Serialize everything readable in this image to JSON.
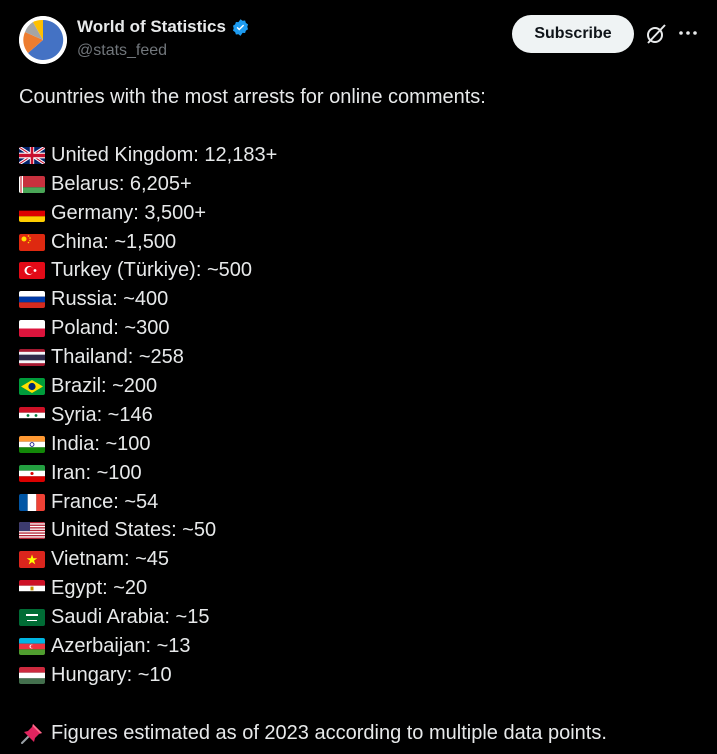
{
  "account": {
    "display_name": "World of Statistics",
    "handle": "@stats_feed",
    "verified": true,
    "avatar_icon": "pie-chart-avatar"
  },
  "actions": {
    "subscribe_label": "Subscribe",
    "grok_icon": "grok-icon",
    "more_icon": "more-icon"
  },
  "tweet": {
    "intro": "Countries with the most arrests for online comments:",
    "items": [
      {
        "flag": "united-kingdom-flag",
        "text": "United Kingdom: 12,183+"
      },
      {
        "flag": "belarus-flag",
        "text": "Belarus: 6,205+"
      },
      {
        "flag": "germany-flag",
        "text": "Germany: 3,500+"
      },
      {
        "flag": "china-flag",
        "text": "China: ~1,500"
      },
      {
        "flag": "turkey-flag",
        "text": "Turkey (Türkiye): ~500"
      },
      {
        "flag": "russia-flag",
        "text": "Russia: ~400"
      },
      {
        "flag": "poland-flag",
        "text": "Poland: ~300"
      },
      {
        "flag": "thailand-flag",
        "text": "Thailand: ~258"
      },
      {
        "flag": "brazil-flag",
        "text": "Brazil: ~200"
      },
      {
        "flag": "syria-flag",
        "text": "Syria: ~146"
      },
      {
        "flag": "india-flag",
        "text": "India: ~100"
      },
      {
        "flag": "iran-flag",
        "text": "Iran: ~100"
      },
      {
        "flag": "france-flag",
        "text": "France: ~54"
      },
      {
        "flag": "united-states-flag",
        "text": "United States: ~50"
      },
      {
        "flag": "vietnam-flag",
        "text": "Vietnam: ~45"
      },
      {
        "flag": "egypt-flag",
        "text": "Egypt: ~20"
      },
      {
        "flag": "saudi-arabia-flag",
        "text": "Saudi Arabia: ~15"
      },
      {
        "flag": "azerbaijan-flag",
        "text": "Azerbaijan: ~13"
      },
      {
        "flag": "hungary-flag",
        "text": "Hungary: ~10"
      }
    ],
    "note_icon": "pushpin-icon",
    "note": "Figures estimated as of 2023 according to multiple data points."
  },
  "colors": {
    "background": "#000000",
    "text": "#e7e9ea",
    "secondary_text": "#71767b",
    "verified_blue": "#1d9bf0",
    "subscribe_bg": "#eff3f4"
  }
}
